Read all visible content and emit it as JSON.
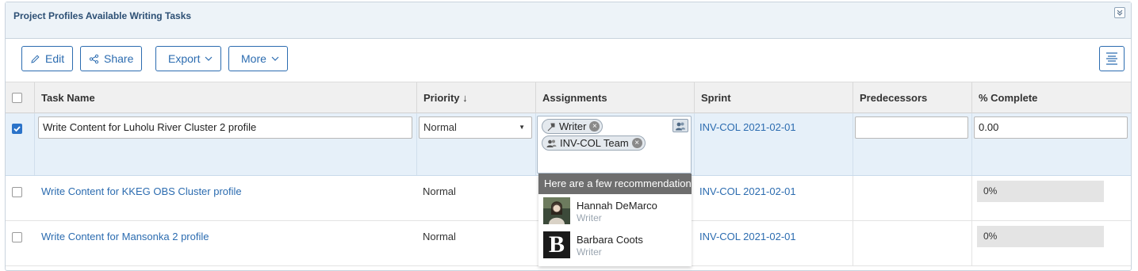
{
  "panel": {
    "title": "Project Profiles Available Writing Tasks"
  },
  "toolbar": {
    "edit_label": "Edit",
    "share_label": "Share",
    "export_label": "Export",
    "more_label": "More"
  },
  "columns": {
    "task_name": "Task Name",
    "priority": "Priority ↓",
    "assignments": "Assignments",
    "sprint": "Sprint",
    "predecessors": "Predecessors",
    "complete": "% Complete"
  },
  "rows": [
    {
      "selected": true,
      "task_name": "Write Content for Luholu River Cluster 2 profile",
      "priority": "Normal",
      "assignments": [
        "Writer",
        "INV-COL Team"
      ],
      "sprint": "INV-COL 2021-02-01",
      "predecessors": "",
      "complete": "0.00"
    },
    {
      "selected": false,
      "task_name": "Write Content for KKEG OBS Cluster profile",
      "priority": "Normal",
      "sprint": "INV-COL 2021-02-01",
      "complete": "0%"
    },
    {
      "selected": false,
      "task_name": "Write Content for Mansonka 2 profile",
      "priority": "Normal",
      "sprint": "INV-COL 2021-02-01",
      "complete": "0%"
    }
  ],
  "recommendations": {
    "header": "Here are a few recommendations",
    "items": [
      {
        "name": "Hannah DeMarco",
        "role": "Writer"
      },
      {
        "name": "Barbara Coots",
        "role": "Writer",
        "avatar_letter": "B"
      }
    ]
  },
  "colors": {
    "accent": "#2c6cb0",
    "header_bg": "#edf3f8",
    "selected_row": "#e6f0f9",
    "dropdown_header": "#6e6e6e"
  }
}
